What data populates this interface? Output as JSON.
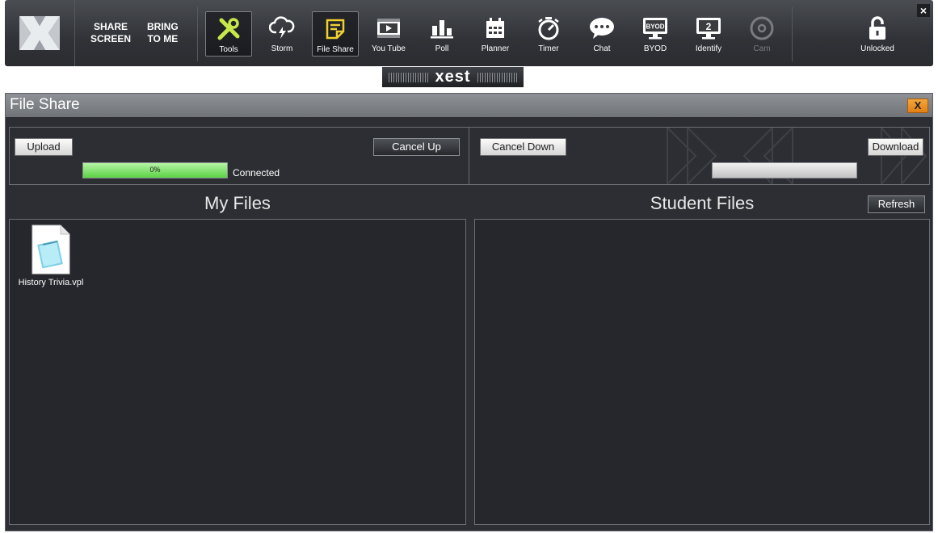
{
  "toolbar": {
    "share_screen": "SHARE\nSCREEN",
    "bring_to_me": "BRING\nTO ME",
    "tools": [
      {
        "label": "Tools",
        "icon": "wrench-screwdriver-icon"
      },
      {
        "label": "Storm",
        "icon": "lightning-cloud-icon"
      },
      {
        "label": "File Share",
        "icon": "file-share-icon"
      },
      {
        "label": "You Tube",
        "icon": "video-icon"
      },
      {
        "label": "Poll",
        "icon": "bar-chart-icon"
      },
      {
        "label": "Planner",
        "icon": "calendar-icon"
      },
      {
        "label": "Timer",
        "icon": "stopwatch-icon"
      },
      {
        "label": "Chat",
        "icon": "chat-bubble-icon"
      },
      {
        "label": "BYOD",
        "icon": "byod-monitor-icon"
      },
      {
        "label": "Identify",
        "icon": "identify-monitor-icon"
      },
      {
        "label": "Cam",
        "icon": "camera-icon"
      }
    ],
    "unlocked": "Unlocked",
    "close": "×",
    "accent": "#c8e84a"
  },
  "brand": {
    "name": "xest"
  },
  "window": {
    "title": "File Share",
    "close": "X",
    "upload": "Upload",
    "cancel_up": "Cancel Up",
    "upload_progress": "0%",
    "upload_progress_value": 0,
    "status": "Connected",
    "cancel_down": "Cancel Down",
    "download": "Download",
    "download_progress_value": 0,
    "my_files_title": "My Files",
    "student_files_title": "Student Files",
    "refresh": "Refresh",
    "my_files": [
      {
        "name": "History Trivia.vpl",
        "icon": "document-notepad-icon"
      }
    ],
    "student_files": []
  }
}
